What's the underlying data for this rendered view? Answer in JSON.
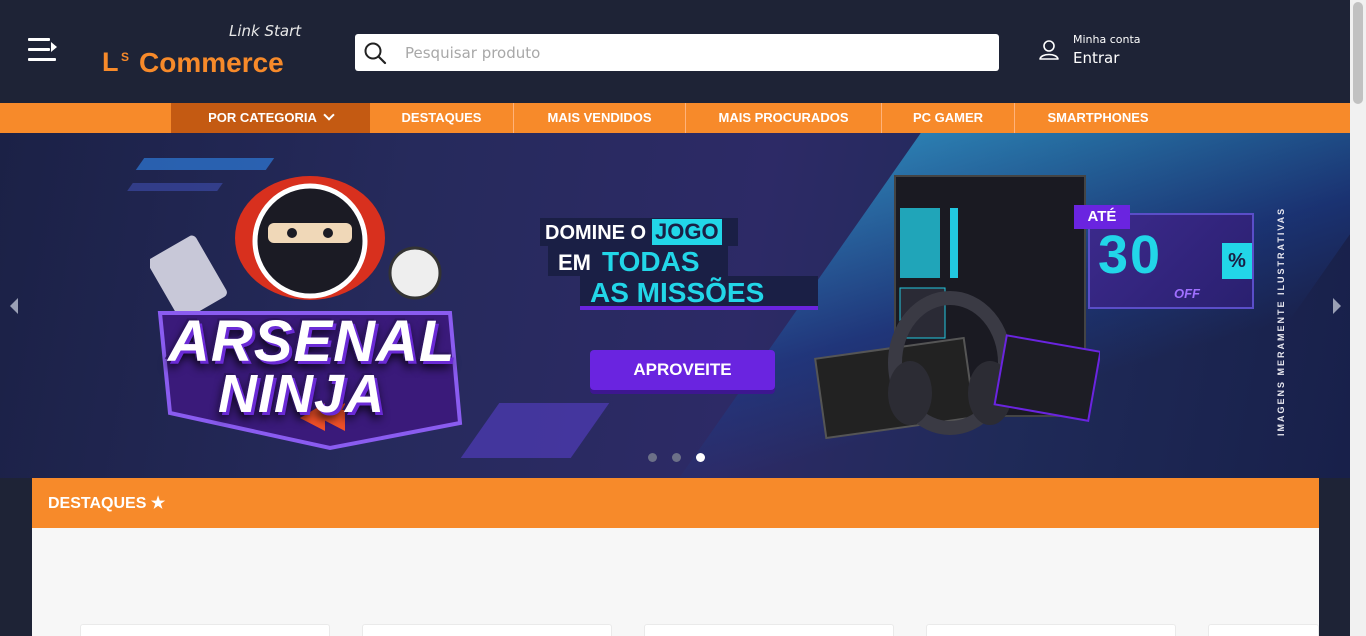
{
  "header": {
    "menu_icon": "menu-icon",
    "logo": {
      "tagline": "Link Start",
      "initial": "L",
      "superscript": "S",
      "name": "Commerce"
    },
    "search": {
      "placeholder": "Pesquisar produto",
      "value": "",
      "icon": "search-icon"
    },
    "account": {
      "label_top": "Minha conta",
      "label_main": "Entrar",
      "icon": "user-icon"
    }
  },
  "nav": {
    "items": [
      {
        "label": "POR CATEGORIA",
        "icon": "chevron-down-icon"
      },
      {
        "label": "DESTAQUES"
      },
      {
        "label": "MAIS VENDIDOS"
      },
      {
        "label": "MAIS PROCURADOS"
      },
      {
        "label": "PC GAMER"
      },
      {
        "label": "SMARTPHONES"
      }
    ]
  },
  "banner": {
    "brand_line1": "ARSENAL",
    "brand_line2": "NINJA",
    "headline_line1_a": "DOMINE O",
    "headline_line1_b": "JOGO",
    "headline_line2_a": "EM",
    "headline_line2_b": "TODAS",
    "headline_line3": "AS MISSÕES",
    "cta_label": "APROVEITE",
    "discount_prefix": "ATÉ",
    "discount_value": "30",
    "discount_sign": "%",
    "discount_suffix": "OFF",
    "side_note": "IMAGENS MERAMENTE ILUSTRATIVAS",
    "slides_total": 3,
    "active_slide": 3,
    "prev_icon": "chevron-left-icon",
    "next_icon": "chevron-right-icon"
  },
  "sections": {
    "highlights": {
      "title": "DESTAQUES ★"
    }
  },
  "colors": {
    "header_bg": "#1e2336",
    "accent": "#f78a2a",
    "accent_dark": "#c45a12",
    "cta": "#6a24e0",
    "cyan": "#22d6e8"
  }
}
